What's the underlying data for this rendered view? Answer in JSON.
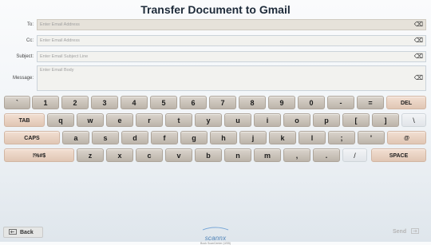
{
  "title": "Transfer Document to Gmail",
  "fields": {
    "to": {
      "label": "To:",
      "placeholder": "Enter Email Address"
    },
    "cc": {
      "label": "Cc:",
      "placeholder": "Enter Email Address"
    },
    "subject": {
      "label": "Subject:",
      "placeholder": "Enter Email Subject Line"
    },
    "message": {
      "label": "Message:",
      "placeholder": "Enter Email Body"
    },
    "clear_icon": "⌫"
  },
  "keyboard": {
    "row1": [
      "`",
      "1",
      "2",
      "3",
      "4",
      "5",
      "6",
      "7",
      "8",
      "9",
      "0",
      "-",
      "="
    ],
    "del": "DEL",
    "tab": "TAB",
    "row2": [
      "q",
      "w",
      "e",
      "r",
      "t",
      "y",
      "u",
      "i",
      "o",
      "p",
      "[",
      "]",
      "\\"
    ],
    "caps": "CAPS",
    "row3": [
      "a",
      "s",
      "d",
      "f",
      "g",
      "h",
      "j",
      "k",
      "l",
      ";",
      "'",
      "@"
    ],
    "sym": "!%#$",
    "row4": [
      "z",
      "x",
      "c",
      "v",
      "b",
      "n",
      "m",
      ",",
      ".",
      "/"
    ],
    "space": "SPACE"
  },
  "footer": {
    "back_label": "Back",
    "send_label": "Send",
    "logo_name": "scannx",
    "logo_sub": "Book ScanCenter (USB)"
  }
}
